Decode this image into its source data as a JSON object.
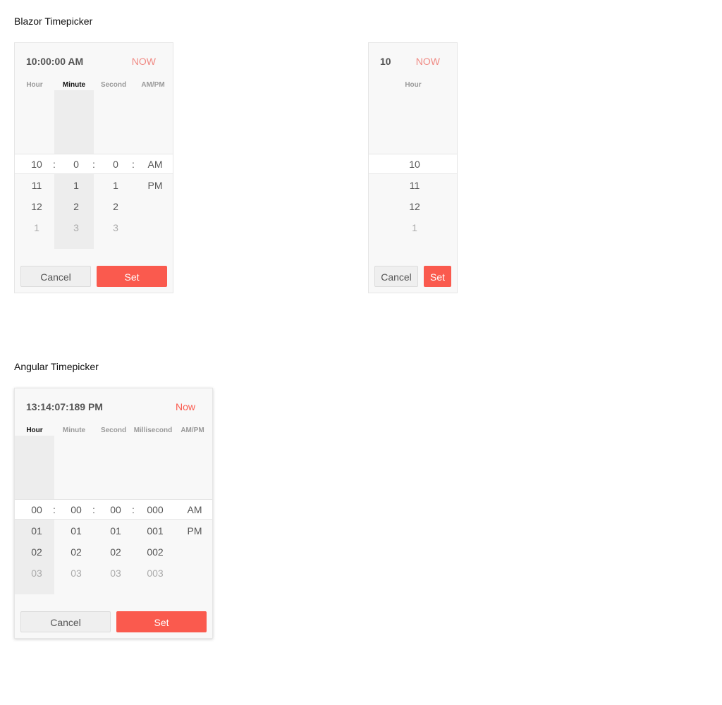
{
  "blazor": {
    "section_title": "Blazor Timepicker",
    "picker1": {
      "time_display": "10:00:00 AM",
      "now_label": "NOW",
      "columns": [
        "Hour",
        "Minute",
        "Second",
        "AM/PM"
      ],
      "active_column": "Minute",
      "selected": [
        "10",
        "0",
        "0",
        "AM"
      ],
      "rows": [
        [
          "11",
          "1",
          "1",
          "PM"
        ],
        [
          "12",
          "2",
          "2",
          ""
        ],
        [
          "1",
          "3",
          "3",
          ""
        ]
      ],
      "cancel_label": "Cancel",
      "set_label": "Set"
    },
    "picker2": {
      "time_display": "10",
      "now_label": "NOW",
      "columns": [
        "Hour"
      ],
      "selected": [
        "10"
      ],
      "rows": [
        [
          "11"
        ],
        [
          "12"
        ],
        [
          "1"
        ]
      ],
      "cancel_label": "Cancel",
      "set_label": "Set"
    }
  },
  "angular": {
    "section_title": "Angular Timepicker",
    "picker": {
      "time_display": "13:14:07:189 PM",
      "now_label": "Now",
      "columns": [
        "Hour",
        "Minute",
        "Second",
        "Millisecond",
        "AM/PM"
      ],
      "active_column": "Hour",
      "selected": [
        "00",
        "00",
        "00",
        "000",
        "AM"
      ],
      "rows": [
        [
          "01",
          "01",
          "01",
          "001",
          "PM"
        ],
        [
          "02",
          "02",
          "02",
          "002",
          ""
        ],
        [
          "03",
          "03",
          "03",
          "003",
          ""
        ]
      ],
      "cancel_label": "Cancel",
      "set_label": "Set"
    }
  },
  "colors": {
    "accent": "#fa5a4e",
    "now_light": "#f08a84",
    "panel_bg": "#f8f8f8",
    "column_shade": "#ededed"
  }
}
